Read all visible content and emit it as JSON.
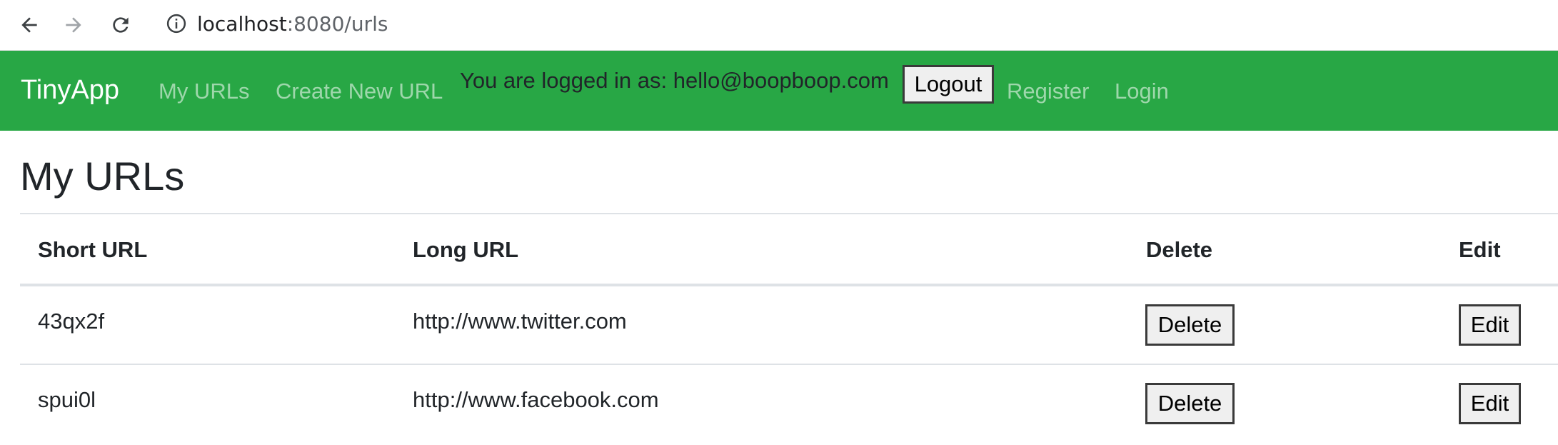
{
  "browser": {
    "url_host": "localhost",
    "url_path": ":8080/urls",
    "icons": [
      "back-arrow-icon",
      "forward-arrow-icon",
      "reload-icon",
      "info-icon"
    ]
  },
  "navbar": {
    "brand": "TinyApp",
    "links": [
      "My URLs",
      "Create New URL",
      "Register",
      "Login"
    ],
    "logged_in_text": "You are logged in as: hello@boopboop.com",
    "logout_label": "Logout",
    "bg_color": "#28a745"
  },
  "main": {
    "title": "My URLs",
    "table": {
      "headers": [
        "Short URL",
        "Long URL",
        "Delete",
        "Edit"
      ],
      "rows": [
        {
          "short": "43qx2f",
          "long": "http://www.twitter.com",
          "delete_label": "Delete",
          "edit_label": "Edit"
        },
        {
          "short": "spui0l",
          "long": "http://www.facebook.com",
          "delete_label": "Delete",
          "edit_label": "Edit"
        }
      ]
    }
  }
}
